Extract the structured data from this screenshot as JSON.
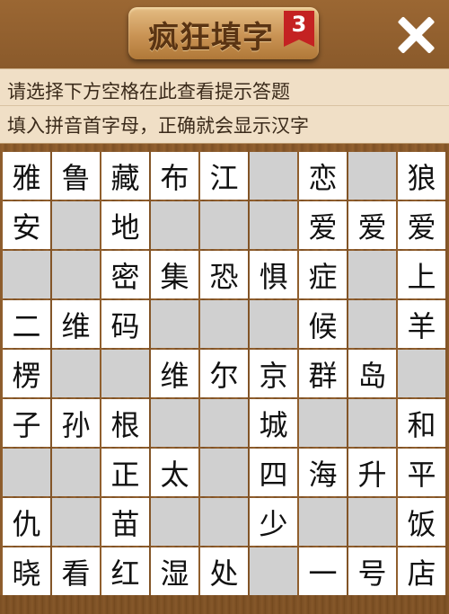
{
  "header": {
    "title": "疯狂填字",
    "level": "3"
  },
  "hints": {
    "line1": "请选择下方空格在此查看提示答题",
    "line2": "填入拼音首字母，正确就会显示汉字"
  },
  "board": {
    "rows": [
      [
        "雅",
        "鲁",
        "藏",
        "布",
        "江",
        "#",
        "恋",
        "#",
        "狼"
      ],
      [
        "安",
        "#",
        "地",
        "#",
        "#",
        "#",
        "爱",
        "爱",
        "爱"
      ],
      [
        "#",
        "#",
        "密",
        "集",
        "恐",
        "惧",
        "症",
        "#",
        "上"
      ],
      [
        "二",
        "维",
        "码",
        "#",
        "#",
        "#",
        "候",
        "#",
        "羊"
      ],
      [
        "楞",
        "#",
        "#",
        "维",
        "尔",
        "京",
        "群",
        "岛",
        "#"
      ],
      [
        "子",
        "孙",
        "根",
        "#",
        "#",
        "城",
        "#",
        "#",
        "和"
      ],
      [
        "#",
        "#",
        "正",
        "太",
        "#",
        "四",
        "海",
        "升",
        "平"
      ],
      [
        "仇",
        "#",
        "苗",
        "#",
        "#",
        "少",
        "#",
        "#",
        "饭"
      ],
      [
        "晓",
        "看",
        "红",
        "湿",
        "处",
        "#",
        "一",
        "号",
        "店"
      ]
    ]
  },
  "colors": {
    "wood": "#8a5a2b",
    "hint_bar": "#f0dfc6",
    "empty_cell": "#d0d0d0",
    "char_cell": "#ffffff",
    "badge": "#c42222"
  },
  "icons": {
    "close": "close-icon",
    "badge": "level-ribbon-icon"
  }
}
